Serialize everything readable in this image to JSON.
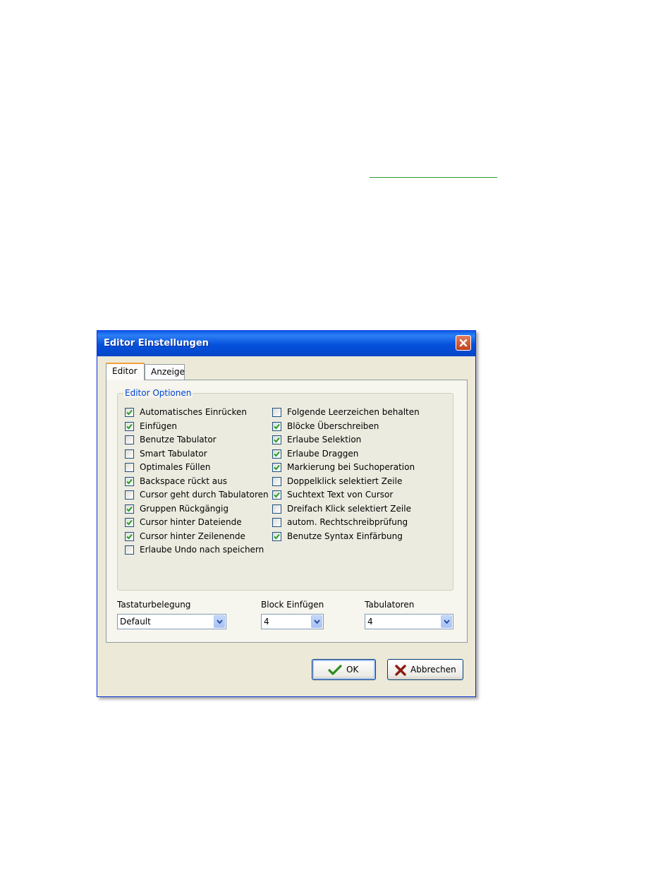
{
  "dialog": {
    "title": "Editor Einstellungen",
    "tabs": [
      {
        "label": "Editor",
        "active": true
      },
      {
        "label": "Anzeige",
        "active": false
      }
    ],
    "group_title": "Editor Optionen",
    "options_left": [
      {
        "label": "Automatisches Einrücken",
        "checked": true
      },
      {
        "label": "Einfügen",
        "checked": true
      },
      {
        "label": "Benutze Tabulator",
        "checked": false
      },
      {
        "label": "Smart Tabulator",
        "checked": false
      },
      {
        "label": "Optimales Füllen",
        "checked": false
      },
      {
        "label": "Backspace rückt aus",
        "checked": true
      },
      {
        "label": "Cursor geht durch Tabulatoren",
        "checked": false
      },
      {
        "label": "Gruppen Rückgängig",
        "checked": true
      },
      {
        "label": "Cursor hinter Dateiende",
        "checked": true
      },
      {
        "label": "Cursor hinter Zeilenende",
        "checked": true
      },
      {
        "label": "Erlaube Undo nach speichern",
        "checked": false
      }
    ],
    "options_right": [
      {
        "label": "Folgende Leerzeichen behalten",
        "checked": false
      },
      {
        "label": "Blöcke Überschreiben",
        "checked": true
      },
      {
        "label": "Erlaube Selektion",
        "checked": true
      },
      {
        "label": "Erlaube Draggen",
        "checked": true
      },
      {
        "label": "Markierung bei Suchoperation",
        "checked": true
      },
      {
        "label": "Doppelklick selektiert Zeile",
        "checked": false
      },
      {
        "label": "Suchtext Text von Cursor",
        "checked": true
      },
      {
        "label": "Dreifach Klick selektiert Zeile",
        "checked": false
      },
      {
        "label": "autom. Rechtschreibprüfung",
        "checked": false
      },
      {
        "label": "Benutze Syntax Einfärbung",
        "checked": true
      }
    ],
    "keymap": {
      "label": "Tastaturbelegung",
      "value": "Default"
    },
    "block_indent": {
      "label": "Block Einfügen",
      "value": "4"
    },
    "tabs_width": {
      "label": "Tabulatoren",
      "value": "4"
    },
    "ok_label": "OK",
    "cancel_label": "Abbrechen",
    "colors": {
      "titlebar": "#0550dc",
      "face": "#ece9d8",
      "accent_link": "#2e9a2e",
      "group_title": "#0046d5"
    }
  }
}
